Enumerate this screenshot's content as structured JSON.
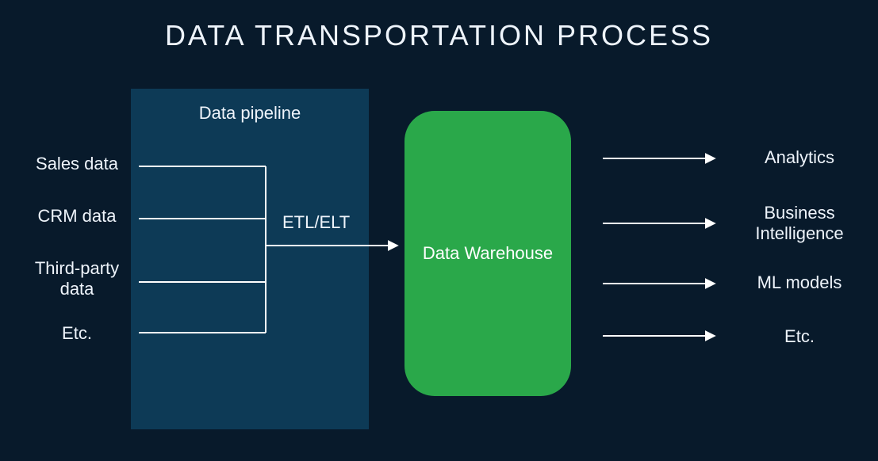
{
  "title": "DATA TRANSPORTATION PROCESS",
  "pipeline": {
    "title": "Data pipeline",
    "process_label": "ETL/ELT",
    "sources": {
      "s1": "Sales data",
      "s2": "CRM data",
      "s3": "Third-party data",
      "s4": "Etc."
    }
  },
  "warehouse": {
    "label": "Data Warehouse"
  },
  "outputs": {
    "o1": "Analytics",
    "o2": "Business Intelligence",
    "o3": "ML models",
    "o4": "Etc."
  },
  "colors": {
    "background": "#081a2b",
    "pipeline_box": "#0d3a56",
    "warehouse": "#2aa84a",
    "text": "#eef4fb",
    "line": "#ffffff"
  }
}
